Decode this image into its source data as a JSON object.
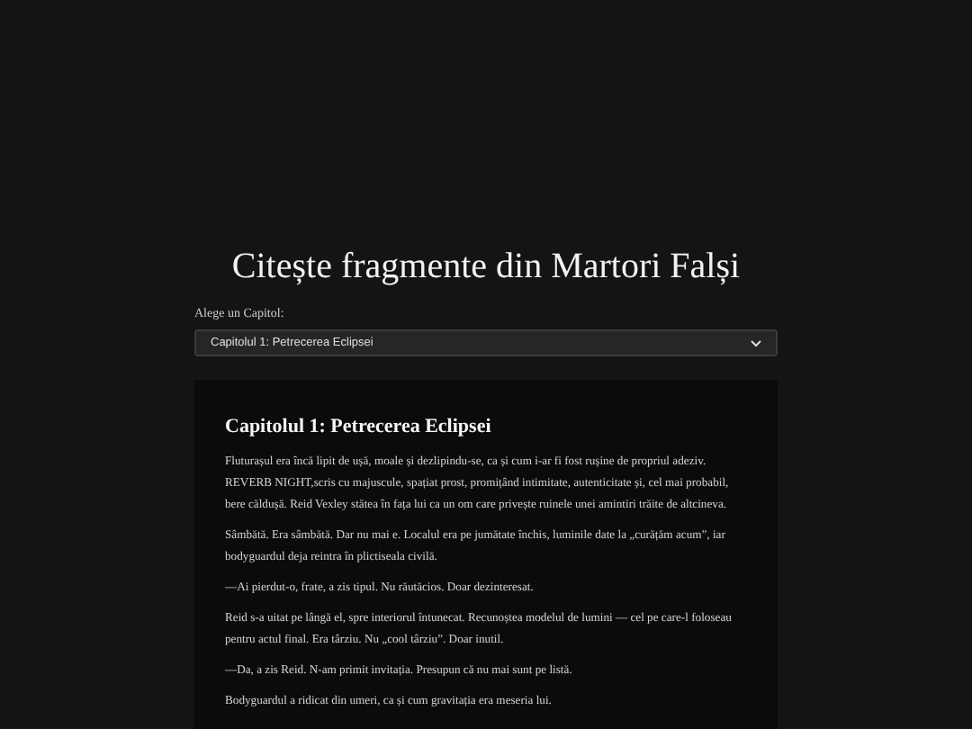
{
  "title": "Citește fragmente din Martori Falși",
  "chapter_select": {
    "label": "Alege un Capitol:",
    "value": "Capitolul 1: Petrecerea Eclipsei"
  },
  "chapter": {
    "heading": "Capitolul 1: Petrecerea Eclipsei",
    "paragraphs": [
      "Fluturașul era încă lipit de ușă, moale și dezlipindu-se, ca și cum i-ar fi fost rușine de propriul adeziv. REVERB NIGHT,scris cu majuscule, spațiat prost, promițând intimitate, autenticitate și, cel mai probabil, bere căldușă. Reid Vexley stătea în fața lui ca un om care privește ruinele unei amintiri trăite de altcineva.",
      "Sâmbătă. Era sâmbătă. Dar nu mai e. Localul era pe jumătate închis, luminile date la „curățăm acum”, iar bodyguardul deja reintra în plictiseala civilă.",
      "—Ai pierdut-o, frate, a zis tipul. Nu răutăcios. Doar dezinteresat.",
      "Reid s-a uitat pe lângă el, spre interiorul întunecat. Recunoștea modelul de lumini — cel pe care-l foloseau pentru actul final. Era târziu. Nu „cool târziu”. Doar inutil.",
      "—Da, a zis Reid. N-am primit invitația. Presupun că nu mai sunt pe listă.",
      "Bodyguardul a ridicat din umeri, ca și cum gravitația era meseria lui."
    ]
  }
}
